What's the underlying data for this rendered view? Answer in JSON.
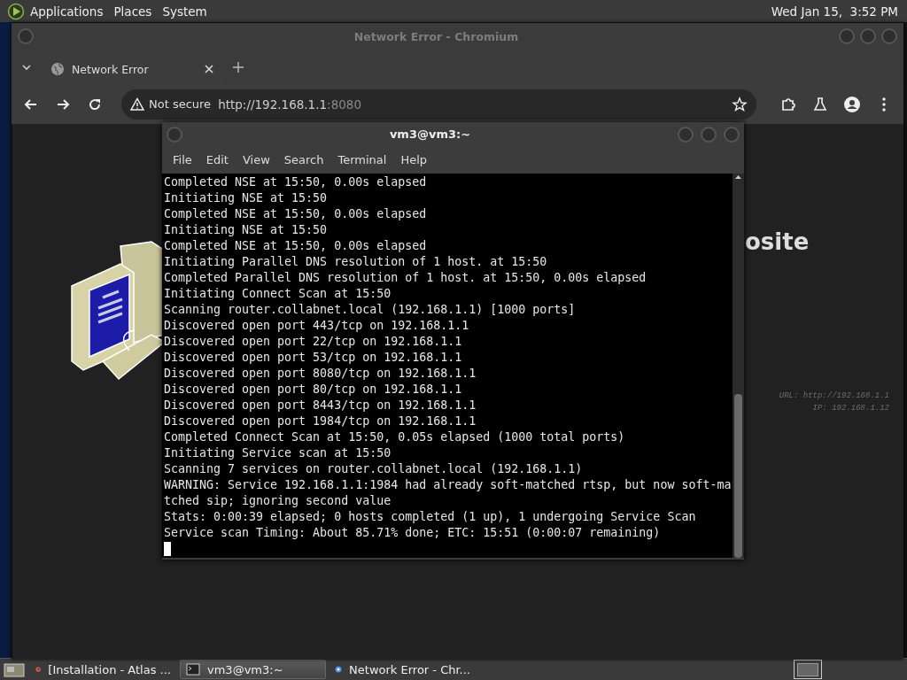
{
  "top_panel": {
    "menus": [
      "Applications",
      "Places",
      "System"
    ],
    "clock": "Wed Jan 15,  3:52 PM"
  },
  "browser": {
    "title": "Network Error - Chromium",
    "tabs": [
      {
        "title": "Network Error",
        "selected": true
      }
    ],
    "security": "Not secure",
    "url": "http://192.168.1.1",
    "url_port": ":8080",
    "page": {
      "heading": "osite",
      "url_line": "URL: http://192.168.1.1",
      "ip_line": "IP: 192.168.1.12"
    }
  },
  "terminal": {
    "title": "vm3@vm3:~",
    "menus": [
      "File",
      "Edit",
      "View",
      "Search",
      "Terminal",
      "Help"
    ],
    "lines": [
      "Completed NSE at 15:50, 0.00s elapsed",
      "Initiating NSE at 15:50",
      "Completed NSE at 15:50, 0.00s elapsed",
      "Initiating NSE at 15:50",
      "Completed NSE at 15:50, 0.00s elapsed",
      "Initiating Parallel DNS resolution of 1 host. at 15:50",
      "Completed Parallel DNS resolution of 1 host. at 15:50, 0.00s elapsed",
      "Initiating Connect Scan at 15:50",
      "Scanning router.collabnet.local (192.168.1.1) [1000 ports]",
      "Discovered open port 443/tcp on 192.168.1.1",
      "Discovered open port 22/tcp on 192.168.1.1",
      "Discovered open port 53/tcp on 192.168.1.1",
      "Discovered open port 8080/tcp on 192.168.1.1",
      "Discovered open port 80/tcp on 192.168.1.1",
      "Discovered open port 8443/tcp on 192.168.1.1",
      "Discovered open port 1984/tcp on 192.168.1.1",
      "Completed Connect Scan at 15:50, 0.05s elapsed (1000 total ports)",
      "Initiating Service scan at 15:50",
      "Scanning 7 services on router.collabnet.local (192.168.1.1)",
      "WARNING: Service 192.168.1.1:1984 had already soft-matched rtsp, but now soft-ma",
      "tched sip; ignoring second value",
      "Stats: 0:00:39 elapsed; 0 hosts completed (1 up), 1 undergoing Service Scan",
      "Service scan Timing: About 85.71% done; ETC: 15:51 (0:00:07 remaining)"
    ]
  },
  "taskbar": {
    "items": [
      {
        "label": "[Installation - Atlas ...",
        "kind": "firefox",
        "selected": false
      },
      {
        "label": "vm3@vm3:~",
        "kind": "terminal",
        "selected": true
      },
      {
        "label": "Network Error - Chr...",
        "kind": "chromium",
        "selected": false
      }
    ]
  }
}
